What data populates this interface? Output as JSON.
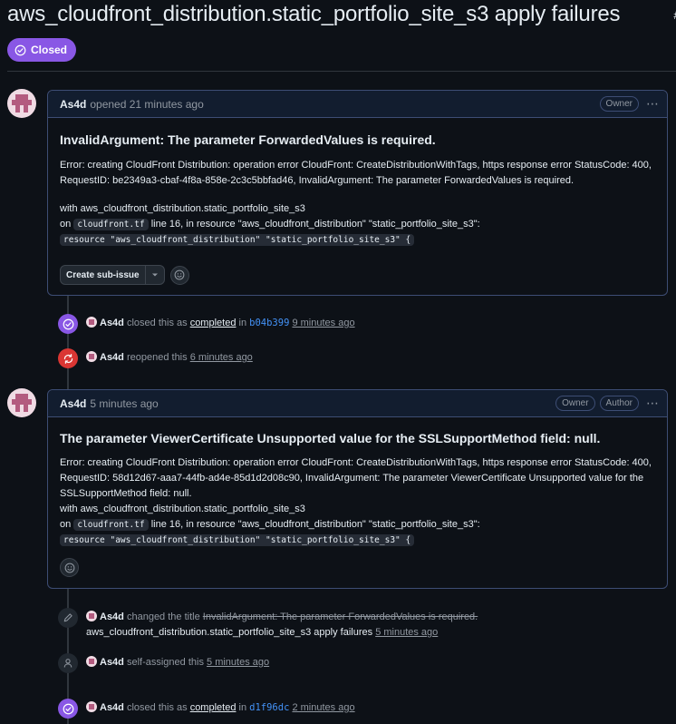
{
  "issue": {
    "title": "aws_cloudfront_distribution.static_portfolio_site_s3 apply failures",
    "title_tail": "#",
    "state": "Closed"
  },
  "comments": [
    {
      "author": "As4d",
      "meta": "opened 21 minutes ago",
      "labels": [
        "Owner"
      ],
      "heading": "InvalidArgument: The parameter ForwardedValues is required.",
      "error_text": "Error: creating CloudFront Distribution: operation error CloudFront: CreateDistributionWithTags, https response error StatusCode: 400, RequestID: be2349a3-cbaf-4f8a-858e-2c3c5bbfad46, InvalidArgument: The parameter ForwardedValues is required.",
      "with_line": "with aws_cloudfront_distribution.static_portfolio_site_s3",
      "on_prefix": "on",
      "file": "cloudfront.tf",
      "on_suffix": "line 16, in resource \"aws_cloudfront_distribution\" \"static_portfolio_site_s3\":",
      "code": "resource \"aws_cloudfront_distribution\" \"static_portfolio_site_s3\" {",
      "sub_issue_button": "Create sub-issue"
    },
    {
      "author": "As4d",
      "meta": "5 minutes ago",
      "labels": [
        "Owner",
        "Author"
      ],
      "heading": "The parameter ViewerCertificate Unsupported value for the SSLSupportMethod field: null.",
      "error_text": "Error: creating CloudFront Distribution: operation error CloudFront: CreateDistributionWithTags, https response error StatusCode: 400, RequestID: 58d12d67-aaa7-44fb-ad4e-85d1d2d08c90, InvalidArgument: The parameter ViewerCertificate Unsupported value for the SSLSupportMethod field: null.",
      "with_line": "with aws_cloudfront_distribution.static_portfolio_site_s3",
      "on_prefix": "on",
      "file": "cloudfront.tf",
      "on_suffix": "line 16, in resource \"aws_cloudfront_distribution\" \"static_portfolio_site_s3\":",
      "code": "resource \"aws_cloudfront_distribution\" \"static_portfolio_site_s3\" {"
    }
  ],
  "events": {
    "closed1": {
      "actor": "As4d",
      "text": "closed this as",
      "reason": "completed",
      "in": "in",
      "commit": "b04b399",
      "time": "9 minutes ago"
    },
    "reopened": {
      "actor": "As4d",
      "text": "reopened this",
      "time": "6 minutes ago"
    },
    "renamed": {
      "actor": "As4d",
      "text": "changed the title",
      "old_title": "InvalidArgument: The parameter ForwardedValues is required.",
      "new_title": "aws_cloudfront_distribution.static_portfolio_site_s3 apply failures",
      "time": "5 minutes ago"
    },
    "assigned": {
      "actor": "As4d",
      "text": "self-assigned this",
      "time": "5 minutes ago"
    },
    "closed2": {
      "actor": "As4d",
      "text": "closed this as",
      "reason": "completed",
      "in": "in",
      "commit": "d1f96dc",
      "time": "2 minutes ago"
    }
  },
  "colors": {
    "closed_purple": "#8957e5",
    "reopened_red": "#da3633",
    "link_blue": "#4493f8",
    "comment_border": "#3d4d74"
  }
}
